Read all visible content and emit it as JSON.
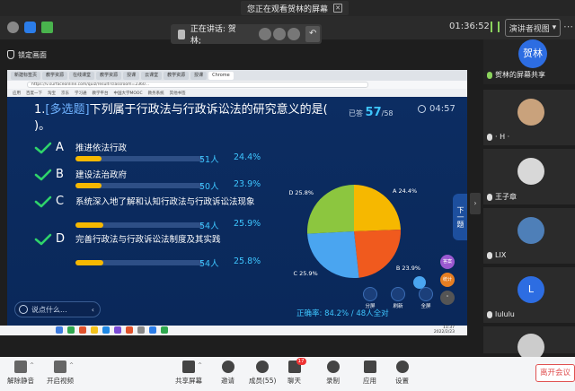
{
  "share_notice": {
    "text": "您正在观看贺林的屏幕"
  },
  "status": {
    "timer": "01:36:52",
    "view_button": "演讲者视图"
  },
  "speaking": {
    "label": "正在讲话: 贺林;"
  },
  "lock_screen": {
    "label": "锁定画面"
  },
  "browser": {
    "tabs": [
      "新建标签页",
      "教学资源",
      "在线课堂",
      "教学资源",
      "授课",
      "云课堂",
      "教学资源",
      "授课",
      "Chrome"
    ],
    "url": "https://v.surfaceonline.com/quiz/result?classroom=2360...",
    "bookmarks": [
      "应用",
      "百度一下",
      "淘宝",
      "京东",
      "学习通",
      "教学平台",
      "中国大学MOOC",
      "教务系统",
      "其他书签"
    ]
  },
  "question": {
    "number": "1.",
    "tag": "[多选题]",
    "text": "下列属于行政法与行政诉讼法的研究意义的是( )。",
    "answered_label": "已答",
    "answered": "57",
    "total": "/58",
    "time": "04:57"
  },
  "options": [
    {
      "letter": "A",
      "text": "推进依法行政",
      "count": "51人",
      "percent": "24.4%",
      "fill": 0.244
    },
    {
      "letter": "B",
      "text": "建设法治政府",
      "count": "50人",
      "percent": "23.9%",
      "fill": 0.239
    },
    {
      "letter": "C",
      "text": "系统深入地了解和认知行政法与行政诉讼法现象",
      "count": "54人",
      "percent": "25.9%",
      "fill": 0.259
    },
    {
      "letter": "D",
      "text": "完善行政法与行政诉讼法制度及其实践",
      "count": "54人",
      "percent": "25.8%",
      "fill": 0.258
    }
  ],
  "chat": {
    "placeholder": "说点什么..."
  },
  "chart_data": {
    "type": "pie",
    "categories": [
      "A",
      "B",
      "C",
      "D"
    ],
    "values": [
      24.4,
      23.9,
      25.9,
      25.8
    ],
    "labels": [
      "A 24.4%",
      "B 23.9%",
      "C 25.9%",
      "D 25.8%"
    ],
    "colors": [
      "#f6b800",
      "#f05a1e",
      "#4aa5f0",
      "#8cc63f"
    ]
  },
  "side_actions": {
    "next": "下一题",
    "answer": "答案",
    "stats": "统计"
  },
  "bottom_tools": [
    "分屏",
    "刷新",
    "全屏"
  ],
  "accuracy": "正确率: 84.2% / 48人全对",
  "taskbar": {
    "time": "11:37",
    "date": "2022/2/23"
  },
  "participants": [
    {
      "name": "贺林的屏幕共享",
      "avatar": "贺林",
      "mic": "on"
    },
    {
      "name": "· H ·",
      "mic": "off"
    },
    {
      "name": "王子章",
      "mic": "off"
    },
    {
      "name": "LIX",
      "mic": "off"
    },
    {
      "name": "lululu",
      "avatar": "L",
      "mic": "off"
    }
  ],
  "toolbar": {
    "mute": "解除静音",
    "video": "开启视频",
    "share": "共享屏幕",
    "invite": "邀请",
    "members": "成员(55)",
    "chat": "聊天",
    "chat_badge": "17",
    "record": "录制",
    "apps": "应用",
    "settings": "设置",
    "leave": "离开会议"
  }
}
